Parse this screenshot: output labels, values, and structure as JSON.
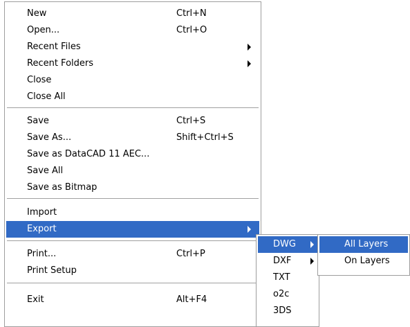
{
  "main_menu": {
    "items": [
      {
        "label": "New",
        "shortcut": "Ctrl+N"
      },
      {
        "label": "Open...",
        "shortcut": "Ctrl+O"
      },
      {
        "label": "Recent Files",
        "shortcut": ""
      },
      {
        "label": "Recent Folders",
        "shortcut": ""
      },
      {
        "label": "Close",
        "shortcut": ""
      },
      {
        "label": "Close All",
        "shortcut": ""
      },
      {
        "label": "Save",
        "shortcut": "Ctrl+S"
      },
      {
        "label": "Save As...",
        "shortcut": "Shift+Ctrl+S"
      },
      {
        "label": "Save as DataCAD 11 AEC...",
        "shortcut": ""
      },
      {
        "label": "Save All",
        "shortcut": ""
      },
      {
        "label": "Save as Bitmap",
        "shortcut": ""
      },
      {
        "label": "Import",
        "shortcut": ""
      },
      {
        "label": "Export",
        "shortcut": ""
      },
      {
        "label": "Print...",
        "shortcut": "Ctrl+P"
      },
      {
        "label": "Print Setup",
        "shortcut": ""
      },
      {
        "label": "Exit",
        "shortcut": "Alt+F4"
      }
    ]
  },
  "export_menu": {
    "items": [
      {
        "label": "DWG"
      },
      {
        "label": "DXF"
      },
      {
        "label": "TXT"
      },
      {
        "label": "o2c"
      },
      {
        "label": "3DS"
      }
    ]
  },
  "dwg_menu": {
    "items": [
      {
        "label": "All Layers"
      },
      {
        "label": "On Layers"
      }
    ]
  },
  "colors": {
    "highlight": "#316ac5",
    "separator": "#a0a0a0"
  }
}
